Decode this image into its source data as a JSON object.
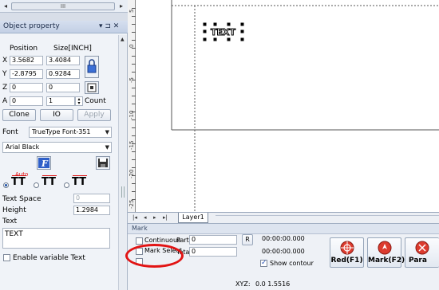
{
  "top_scrollbar": {
    "thumb_grip": "III"
  },
  "object_property": {
    "title": "Object property",
    "pin_glyph": "▾ ⊐ ✕",
    "headers": {
      "position": "Position",
      "size": "Size[INCH]"
    },
    "x": {
      "label": "X",
      "pos": "3.5682",
      "size": "3.4084"
    },
    "y": {
      "label": "Y",
      "pos": "-2.8795",
      "size": "0.9284"
    },
    "z": {
      "label": "Z",
      "pos": "0",
      "size": "0"
    },
    "a": {
      "label": "A",
      "pos": "0",
      "size": "1",
      "count_label": "Count"
    },
    "buttons": {
      "clone": "Clone",
      "io": "IO",
      "apply": "Apply"
    },
    "font_label": "Font",
    "font_type": "TrueType Font-351",
    "font_name": "Arial Black",
    "auto_label": "Auto",
    "text_space_label": "Text Space",
    "text_space_value": "0",
    "height_label": "Height",
    "height_value": "1.2984",
    "text_label": "Text",
    "text_value": "TEXT",
    "enable_variable_label": "Enable variable Text"
  },
  "canvas": {
    "object_text": "TEXT",
    "ruler_labels": [
      "5",
      "0",
      "-5",
      "-10",
      "-15",
      "-20",
      "-25"
    ]
  },
  "tabs": {
    "active": "Layer1"
  },
  "mark": {
    "title": "Mark",
    "continuous_label": "Continuous",
    "mark_select_label": "Mark Select",
    "part_label": "Part",
    "part_value": "0",
    "total_label": "Total",
    "total_value": "0",
    "r_button": "R",
    "time1": "00:00:00.000",
    "time2": "00:00:00.000",
    "show_contour_label": "Show contour",
    "buttons": [
      {
        "label": "Red(F1)",
        "color": "#d9342b"
      },
      {
        "label": "Mark(F2)",
        "color": "#d93a2b"
      },
      {
        "label": "Para",
        "color": "#d9342b"
      }
    ]
  },
  "status": {
    "coord_label": "XYZ:",
    "coord_value": "0.0 1.5516"
  }
}
